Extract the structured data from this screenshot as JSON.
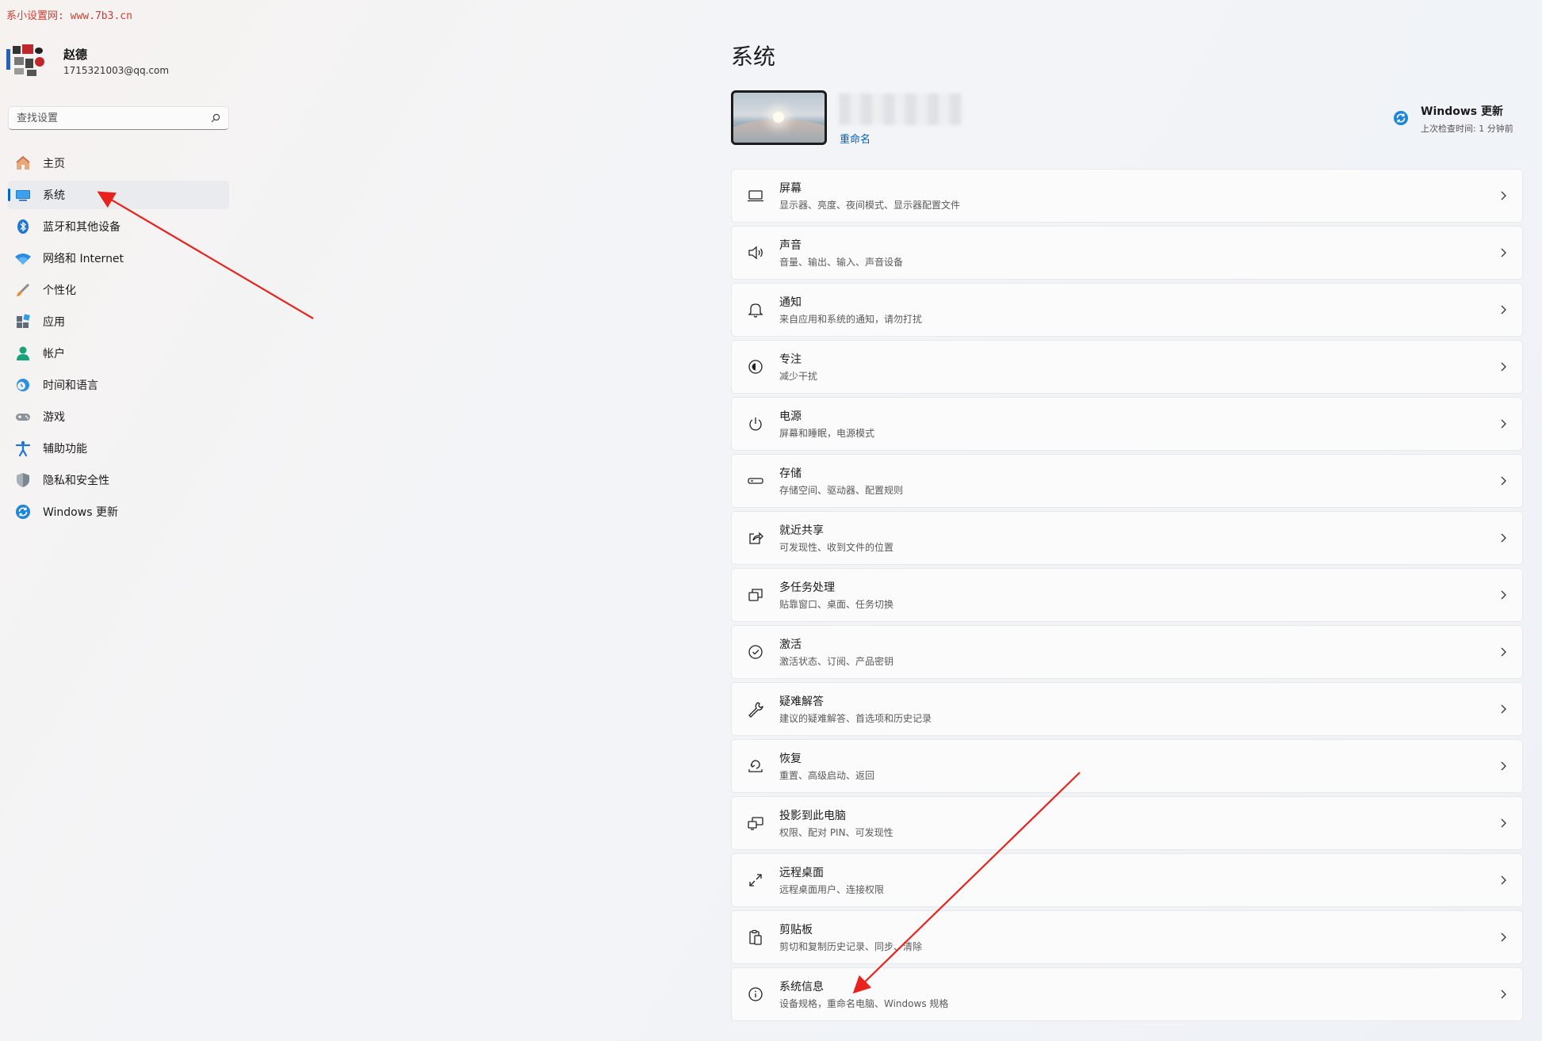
{
  "watermark": "系小设置网: www.7b3.cn",
  "profile": {
    "name": "赵德",
    "email": "1715321003@qq.com"
  },
  "search": {
    "placeholder": "查找设置"
  },
  "nav": [
    {
      "label": "主页",
      "icon": "home-icon"
    },
    {
      "label": "系统",
      "icon": "system-icon",
      "active": true
    },
    {
      "label": "蓝牙和其他设备",
      "icon": "bluetooth-icon"
    },
    {
      "label": "网络和 Internet",
      "icon": "wifi-icon"
    },
    {
      "label": "个性化",
      "icon": "brush-icon"
    },
    {
      "label": "应用",
      "icon": "apps-icon"
    },
    {
      "label": "帐户",
      "icon": "account-icon"
    },
    {
      "label": "时间和语言",
      "icon": "globe-clock-icon"
    },
    {
      "label": "游戏",
      "icon": "gamepad-icon"
    },
    {
      "label": "辅助功能",
      "icon": "accessibility-icon"
    },
    {
      "label": "隐私和安全性",
      "icon": "shield-icon"
    },
    {
      "label": "Windows 更新",
      "icon": "update-icon"
    }
  ],
  "main": {
    "title": "系统",
    "rename": "重命名",
    "windows_update": {
      "title": "Windows 更新",
      "subtitle": "上次检查时间: 1 分钟前"
    },
    "cards": [
      {
        "title": "屏幕",
        "subtitle": "显示器、亮度、夜间模式、显示器配置文件",
        "icon": "display-icon"
      },
      {
        "title": "声音",
        "subtitle": "音量、输出、输入、声音设备",
        "icon": "speaker-icon"
      },
      {
        "title": "通知",
        "subtitle": "来自应用和系统的通知，请勿打扰",
        "icon": "bell-icon"
      },
      {
        "title": "专注",
        "subtitle": "减少干扰",
        "icon": "focus-icon"
      },
      {
        "title": "电源",
        "subtitle": "屏幕和睡眠，电源模式",
        "icon": "power-icon"
      },
      {
        "title": "存储",
        "subtitle": "存储空间、驱动器、配置规则",
        "icon": "storage-icon"
      },
      {
        "title": "就近共享",
        "subtitle": "可发现性、收到文件的位置",
        "icon": "share-icon"
      },
      {
        "title": "多任务处理",
        "subtitle": "贴靠窗口、桌面、任务切换",
        "icon": "multitask-icon"
      },
      {
        "title": "激活",
        "subtitle": "激活状态、订阅、产品密钥",
        "icon": "activation-icon"
      },
      {
        "title": "疑难解答",
        "subtitle": "建议的疑难解答、首选项和历史记录",
        "icon": "wrench-icon"
      },
      {
        "title": "恢复",
        "subtitle": "重置、高级启动、返回",
        "icon": "recovery-icon"
      },
      {
        "title": "投影到此电脑",
        "subtitle": "权限、配对 PIN、可发现性",
        "icon": "project-icon"
      },
      {
        "title": "远程桌面",
        "subtitle": "远程桌面用户、连接权限",
        "icon": "remote-desktop-icon"
      },
      {
        "title": "剪贴板",
        "subtitle": "剪切和复制历史记录、同步、清除",
        "icon": "clipboard-icon"
      },
      {
        "title": "系统信息",
        "subtitle": "设备规格，重命名电脑、Windows 规格",
        "icon": "info-icon"
      }
    ]
  },
  "colors": {
    "accent": "#0067c0",
    "link": "#005fb8",
    "annotation": "#e8231d"
  }
}
